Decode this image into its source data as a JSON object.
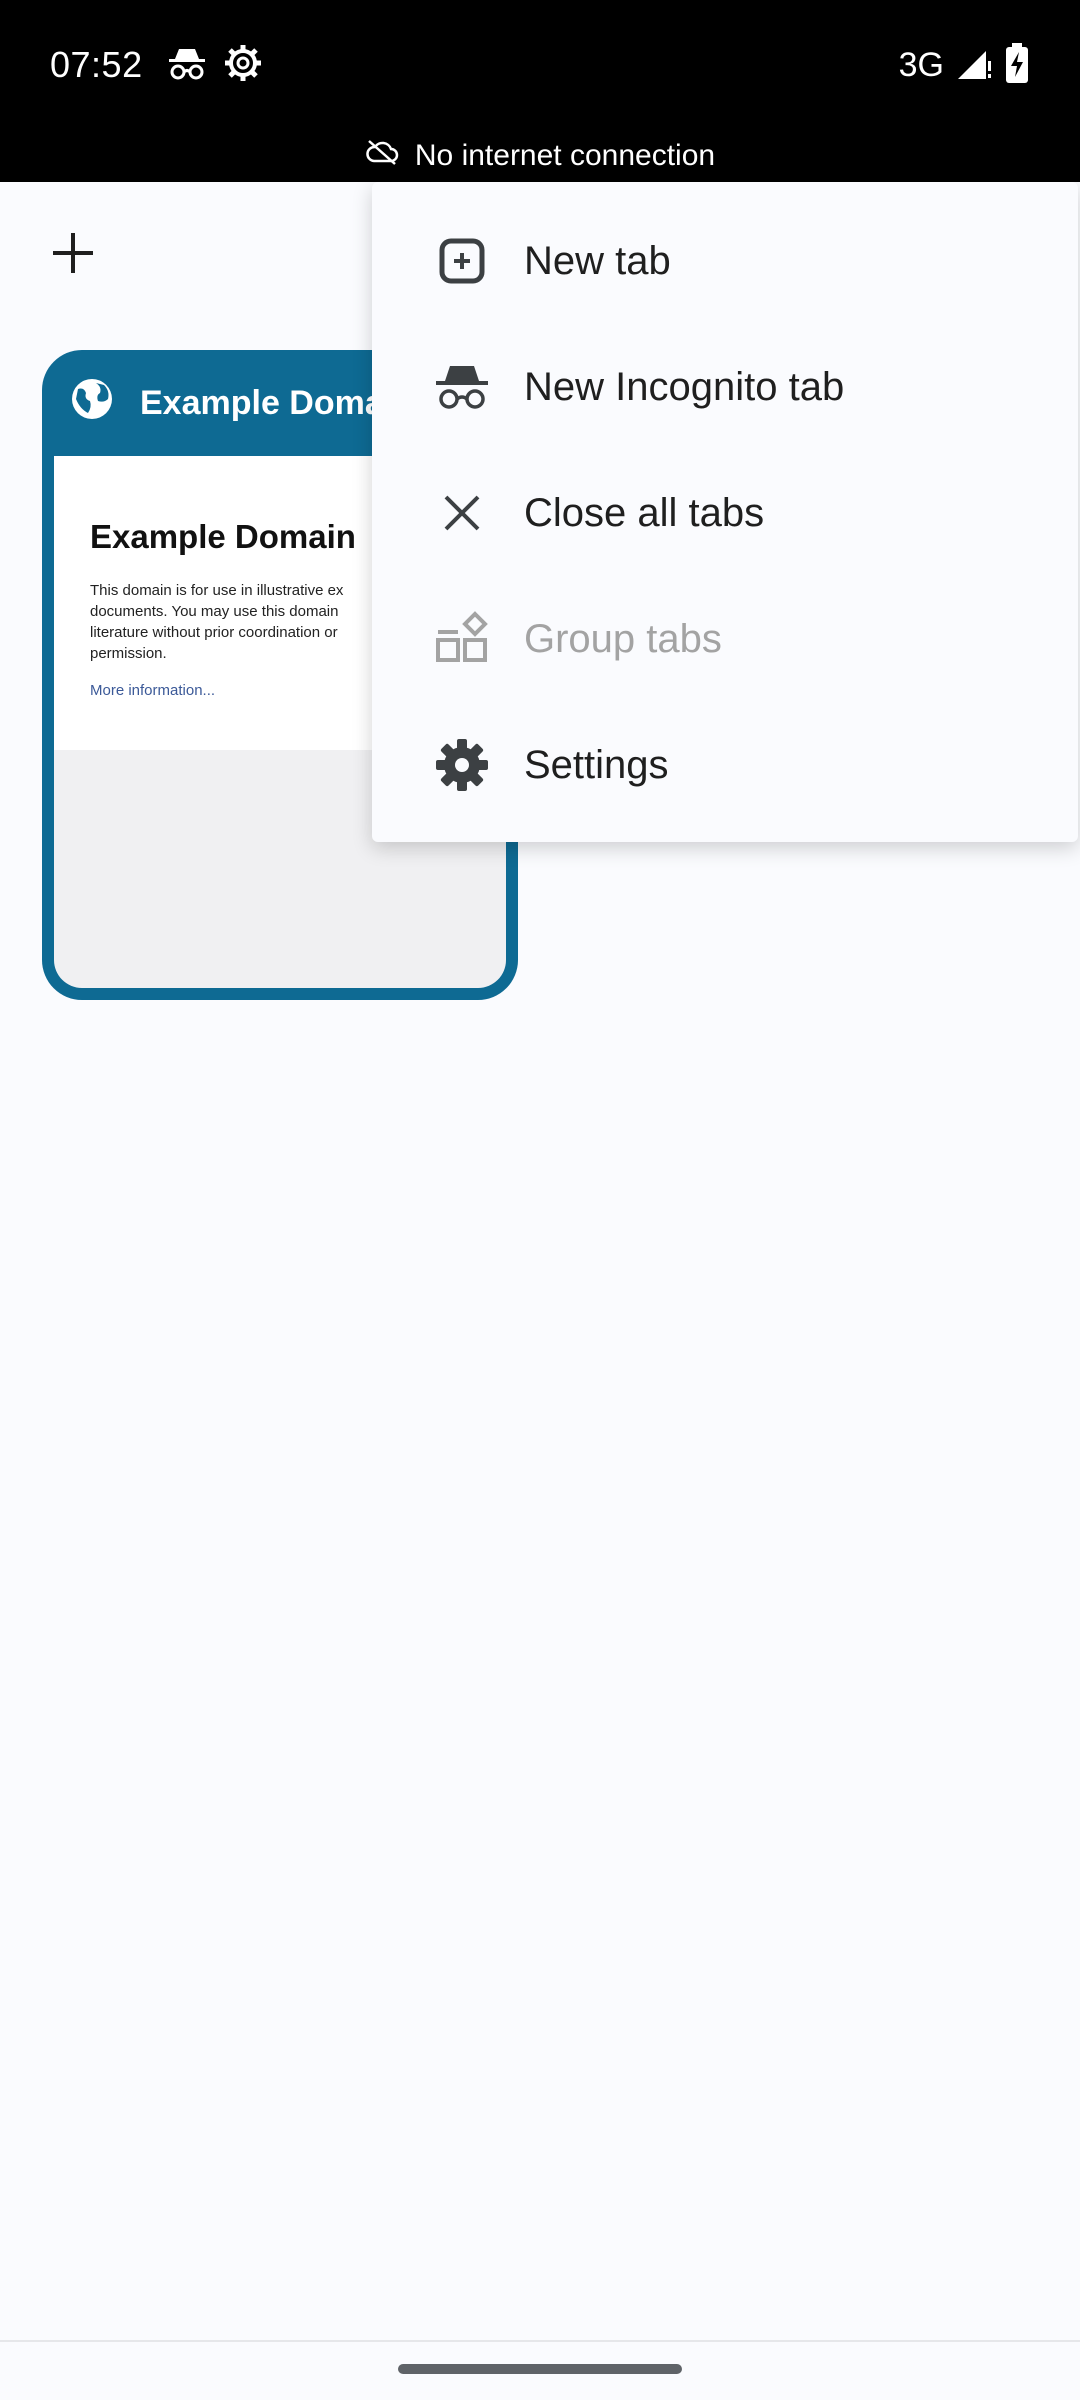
{
  "status_bar": {
    "time": "07:52",
    "network": "3G",
    "icons": [
      "incognito-icon",
      "settings-gear-icon",
      "signal-icon",
      "battery-charging-icon"
    ]
  },
  "offline_banner": {
    "text": "No internet connection",
    "icon": "cloud-off-icon"
  },
  "toolbar": {
    "add_tab_icon": "plus-icon"
  },
  "tab_card": {
    "title": "Example Domain",
    "favicon": "globe-icon",
    "thumbnail": {
      "heading": "Example Domain",
      "body": "This domain is for use in illustrative ex\ndocuments. You may use this domain\nliterature without prior coordination or\npermission.",
      "link": "More information..."
    },
    "accent_color": "#0e6a93"
  },
  "menu": {
    "items": [
      {
        "label": "New tab",
        "icon": "new-tab-icon",
        "enabled": true
      },
      {
        "label": "New Incognito tab",
        "icon": "incognito-icon",
        "enabled": true
      },
      {
        "label": "Close all tabs",
        "icon": "close-icon",
        "enabled": true
      },
      {
        "label": "Group tabs",
        "icon": "group-tabs-icon",
        "enabled": false
      },
      {
        "label": "Settings",
        "icon": "settings-icon",
        "enabled": true
      }
    ]
  }
}
